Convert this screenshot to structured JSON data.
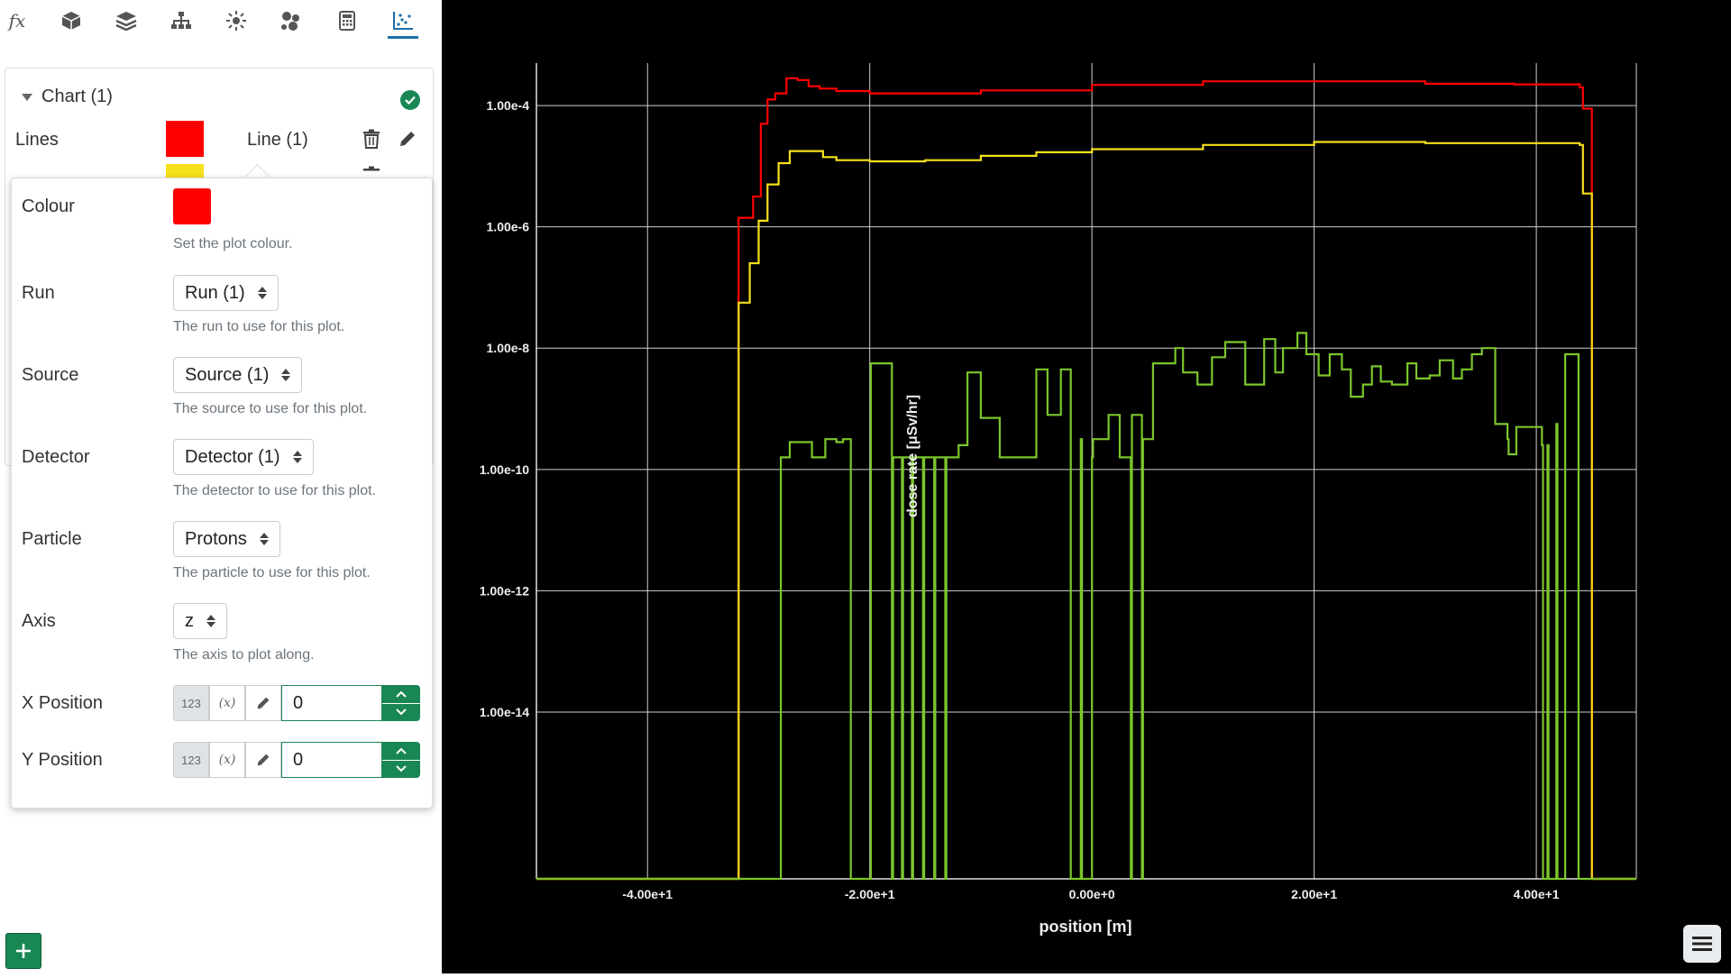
{
  "toolbar": {
    "items": [
      {
        "name": "fx-icon",
        "glyph": "fx"
      },
      {
        "name": "cube-icon"
      },
      {
        "name": "layers-icon"
      },
      {
        "name": "hierarchy-icon"
      },
      {
        "name": "sun-icon"
      },
      {
        "name": "molecule-icon"
      },
      {
        "name": "calculator-icon"
      },
      {
        "name": "chart-icon",
        "active": true
      }
    ]
  },
  "chart": {
    "title": "Chart (1)",
    "lines_label": "Lines",
    "lines": [
      {
        "label": "Line (1)",
        "color": "#ff0000"
      },
      {
        "label": "",
        "color": "#f6e11b"
      }
    ]
  },
  "popover": {
    "colour_label": "Colour",
    "colour_value": "#ff0000",
    "colour_help": "Set the plot colour.",
    "run_label": "Run",
    "run_value": "Run (1)",
    "run_help": "The run to use for this plot.",
    "source_label": "Source",
    "source_value": "Source (1)",
    "source_help": "The source to use for this plot.",
    "detector_label": "Detector",
    "detector_value": "Detector (1)",
    "detector_help": "The detector to use for this plot.",
    "particle_label": "Particle",
    "particle_value": "Protons",
    "particle_help": "The particle to use for this plot.",
    "axis_label": "Axis",
    "axis_value": "z",
    "axis_help": "The axis to plot along.",
    "xpos_label": "X Position",
    "xpos_value": "0",
    "ypos_label": "Y Position",
    "ypos_value": "0",
    "num_mode_label": "123",
    "expr_mode_label": "(x)"
  },
  "chart_data": {
    "type": "line",
    "xlabel": "position [m]",
    "ylabel": "dose rate [μSv/hr]",
    "xlim": [
      -50,
      49
    ],
    "ylog": true,
    "ylim_log10": [
      -16.75,
      -3.3
    ],
    "xticks": [
      -40,
      -20,
      0,
      20,
      40
    ],
    "xtick_labels": [
      "-4.00e+1",
      "-2.00e+1",
      "0.00e+0",
      "2.00e+1",
      "4.00e+1"
    ],
    "yticks_log10": [
      -4,
      -6,
      -8,
      -10,
      -12,
      -14
    ],
    "ytick_labels": [
      "1.00e-4",
      "1.00e-6",
      "1.00e-8",
      "1.00e-10",
      "1.00e-12",
      "1.00e-14"
    ],
    "grid": true,
    "series": [
      {
        "color": "#ff0000",
        "x": [
          -50,
          -32,
          -31.8,
          -30.5,
          -29.8,
          -29.2,
          -28.5,
          -27.5,
          -26.5,
          -25.5,
          -24.5,
          -23,
          -20,
          -17,
          -10,
          0,
          10,
          20,
          30,
          38,
          40,
          43.9,
          44.2,
          45,
          49
        ],
        "y_log10": [
          -16.75,
          -16.75,
          -5.85,
          -5.5,
          -4.3,
          -3.9,
          -3.8,
          -3.55,
          -3.58,
          -3.68,
          -3.72,
          -3.76,
          -3.8,
          -3.8,
          -3.75,
          -3.66,
          -3.6,
          -3.6,
          -3.64,
          -3.65,
          -3.65,
          -3.7,
          -4.05,
          -16.75,
          -16.75
        ]
      },
      {
        "color": "#f6e11b",
        "x": [
          -50,
          -32,
          -31.8,
          -30.8,
          -30,
          -29.2,
          -28.2,
          -27.2,
          -24.2,
          -23,
          -20,
          -15,
          -10,
          -5,
          0,
          10,
          20,
          30,
          40,
          43.9,
          44.2,
          45,
          49
        ],
        "y_log10": [
          -16.75,
          -16.75,
          -7.25,
          -6.6,
          -5.9,
          -5.3,
          -4.95,
          -4.75,
          -4.85,
          -4.9,
          -4.92,
          -4.9,
          -4.83,
          -4.77,
          -4.72,
          -4.65,
          -4.6,
          -4.62,
          -4.62,
          -4.65,
          -5.45,
          -16.75,
          -16.75
        ]
      },
      {
        "color": "#7cc52b",
        "x": [
          -50,
          -28.2,
          -28,
          -27.2,
          -25.2,
          -24,
          -23,
          -22.4,
          -21.7,
          -20.2,
          -19.9,
          -18,
          -17.9,
          -17.1,
          -17,
          -16.2,
          -16.1,
          -15.2,
          -15.1,
          -14.2,
          -14.1,
          -13.2,
          -13.1,
          -12,
          -11.2,
          -10,
          -8.3,
          -5,
          -4,
          -2.8,
          -1.9,
          -1,
          -0.9,
          0,
          0.1,
          1.5,
          2.5,
          3.5,
          3.6,
          4.5,
          4.6,
          5.5,
          7.5,
          8.2,
          9.5,
          10.8,
          12,
          13.8,
          14.5,
          15.5,
          16.5,
          17.2,
          18.5,
          19.3,
          20.4,
          21.4,
          22.5,
          23.3,
          24.4,
          25.2,
          26,
          27,
          28.4,
          29.2,
          30.4,
          31.3,
          32.5,
          33.3,
          34.2,
          35.1,
          36.3,
          37.4,
          37.5,
          38.2,
          40.5,
          40.6,
          41,
          41.1,
          41.8,
          41.9,
          42.6,
          43.8,
          49
        ],
        "y_log10": [
          -16.75,
          -16.75,
          -9.8,
          -9.55,
          -9.8,
          -9.5,
          -9.55,
          -9.5,
          -16.75,
          -16.75,
          -8.25,
          -16.75,
          -9.8,
          -16.75,
          -9.8,
          -16.75,
          -9.8,
          -16.75,
          -9.8,
          -16.75,
          -9.8,
          -16.75,
          -9.8,
          -9.6,
          -8.4,
          -9.15,
          -9.8,
          -8.35,
          -9.1,
          -8.35,
          -16.75,
          -9.5,
          -16.75,
          -9.8,
          -9.5,
          -9.1,
          -9.8,
          -16.75,
          -9.1,
          -16.75,
          -9.5,
          -8.25,
          -8.0,
          -8.4,
          -8.6,
          -8.15,
          -7.9,
          -8.6,
          -8.6,
          -7.85,
          -8.4,
          -8.0,
          -7.75,
          -8.1,
          -8.45,
          -8.1,
          -8.35,
          -8.8,
          -8.6,
          -8.3,
          -8.55,
          -8.6,
          -8.25,
          -8.5,
          -8.45,
          -8.2,
          -8.5,
          -8.35,
          -8.1,
          -8.0,
          -9.25,
          -9.5,
          -9.75,
          -9.3,
          -9.6,
          -16.75,
          -9.6,
          -16.75,
          -9.25,
          -16.75,
          -8.1,
          -16.75,
          -16.75
        ]
      }
    ]
  }
}
